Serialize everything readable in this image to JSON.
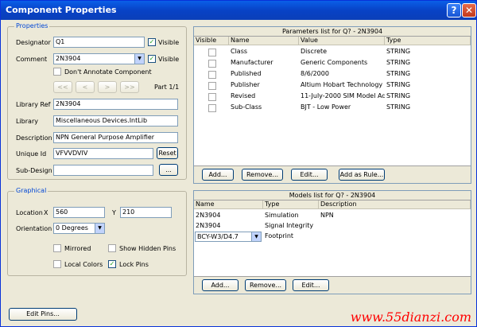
{
  "window": {
    "title": "Component Properties",
    "help_glyph": "?",
    "close_glyph": "✕"
  },
  "properties": {
    "group_title": "Properties",
    "designator_label": "Designator",
    "designator_value": "Q1",
    "visible_label": "Visible",
    "comment_label": "Comment",
    "comment_value": "2N3904",
    "comment_visible_label": "Visible",
    "dont_annotate_label": "Don't Annotate Component",
    "part_nav": [
      "<<",
      "<",
      ">",
      ">>"
    ],
    "part_label": "Part 1/1",
    "library_ref_label": "Library Ref",
    "library_ref_value": "2N3904",
    "library_label": "Library",
    "library_value": "Miscellaneous Devices.IntLib",
    "description_label": "Description",
    "description_value": "NPN General Purpose Amplifier",
    "unique_id_label": "Unique Id",
    "unique_id_value": "VFVVDVIV",
    "reset_label": "Reset",
    "sub_design_label": "Sub-Design",
    "sub_design_value": "",
    "browse_label": "..."
  },
  "graphical": {
    "group_title": "Graphical",
    "location_label": "Location",
    "x_label": "X",
    "x_value": "560",
    "y_label": "Y",
    "y_value": "210",
    "orientation_label": "Orientation",
    "orientation_value": "0 Degrees",
    "mirrored_label": "Mirrored",
    "show_hidden_pins_label": "Show Hidden Pins",
    "local_colors_label": "Local Colors",
    "lock_pins_label": "Lock Pins"
  },
  "parameters": {
    "header": "Parameters list for Q? - 2N3904",
    "columns": [
      "Visible",
      "Name",
      "Value",
      "Type"
    ],
    "rows": [
      {
        "name": "Class",
        "value": "Discrete",
        "type": "STRING"
      },
      {
        "name": "Manufacturer",
        "value": "Generic Components",
        "type": "STRING"
      },
      {
        "name": "Published",
        "value": "8/6/2000",
        "type": "STRING"
      },
      {
        "name": "Publisher",
        "value": "Altium Hobart Technology Cen",
        "type": "STRING"
      },
      {
        "name": "Revised",
        "value": "11-July-2000  SIM Model Adde",
        "type": "STRING"
      },
      {
        "name": "Sub-Class",
        "value": "BJT - Low Power",
        "type": "STRING"
      }
    ],
    "buttons": [
      "Add...",
      "Remove...",
      "Edit...",
      "Add as Rule..."
    ]
  },
  "models": {
    "header": "Models list for Q? - 2N3904",
    "columns": [
      "Name",
      "Type",
      "Description"
    ],
    "rows": [
      {
        "name": "2N3904",
        "type": "Simulation",
        "description": "NPN"
      },
      {
        "name": "2N3904",
        "type": "Signal Integrity",
        "description": ""
      },
      {
        "name": "BCY-W3/D4.7",
        "type": "Footprint",
        "description": ""
      }
    ],
    "buttons": [
      "Add...",
      "Remove...",
      "Edit..."
    ]
  },
  "footer": {
    "edit_pins_label": "Edit Pins..."
  },
  "watermark": "www.55dianzi.com",
  "colors": {
    "title_bar": "#0842c6",
    "group_title": "#0046d5",
    "check": "#21a121",
    "watermark": "#ff0000"
  }
}
